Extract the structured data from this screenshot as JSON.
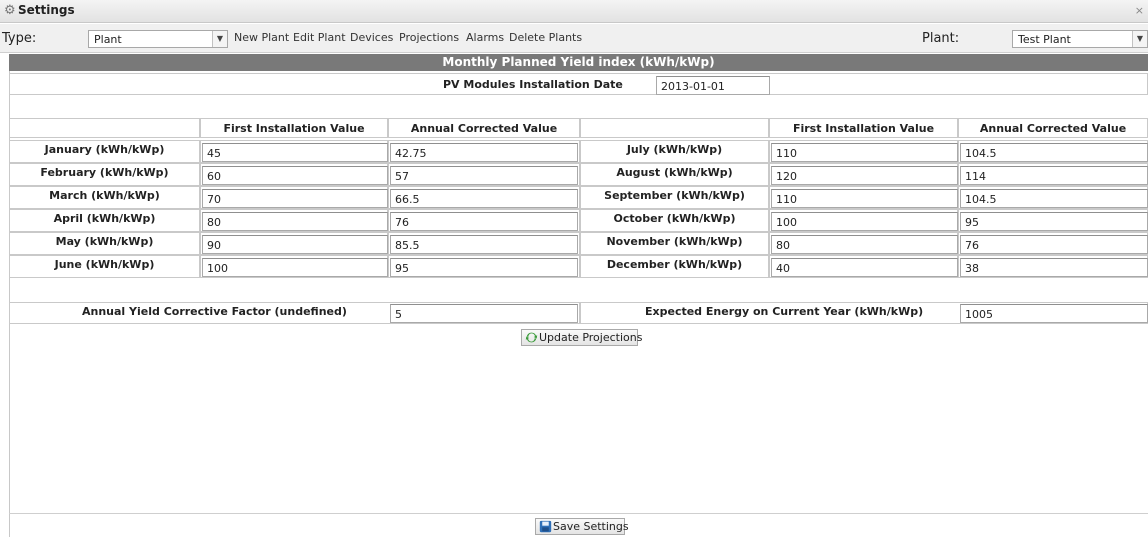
{
  "window": {
    "title": "Settings",
    "close": "×"
  },
  "toolbar": {
    "type_label": "Type:",
    "type_value": "Plant",
    "links": [
      "New Plant",
      "Edit Plant",
      "Devices",
      "Projections",
      "Alarms",
      "Delete Plants"
    ],
    "plant_label": "Plant:",
    "plant_value": "Test Plant"
  },
  "section_title": "Monthly Planned Yield index (kWh/kWp)",
  "install_date": {
    "label": "PV Modules Installation Date",
    "value": "2013-01-01"
  },
  "columns": {
    "first": "First Installation Value",
    "corrected": "Annual Corrected Value"
  },
  "months_left": [
    {
      "label": "January (kWh/kWp)",
      "first": "45",
      "corrected": "42.75"
    },
    {
      "label": "February (kWh/kWp)",
      "first": "60",
      "corrected": "57"
    },
    {
      "label": "March (kWh/kWp)",
      "first": "70",
      "corrected": "66.5"
    },
    {
      "label": "April (kWh/kWp)",
      "first": "80",
      "corrected": "76"
    },
    {
      "label": "May (kWh/kWp)",
      "first": "90",
      "corrected": "85.5"
    },
    {
      "label": "June (kWh/kWp)",
      "first": "100",
      "corrected": "95"
    }
  ],
  "months_right": [
    {
      "label": "July (kWh/kWp)",
      "first": "110",
      "corrected": "104.5"
    },
    {
      "label": "August (kWh/kWp)",
      "first": "120",
      "corrected": "114"
    },
    {
      "label": "September (kWh/kWp)",
      "first": "110",
      "corrected": "104.5"
    },
    {
      "label": "October (kWh/kWp)",
      "first": "100",
      "corrected": "95"
    },
    {
      "label": "November (kWh/kWp)",
      "first": "80",
      "corrected": "76"
    },
    {
      "label": "December (kWh/kWp)",
      "first": "40",
      "corrected": "38"
    }
  ],
  "corrective_factor": {
    "label": "Annual Yield Corrective Factor (undefined)",
    "value": "5"
  },
  "expected_energy": {
    "label": "Expected Energy on Current Year (kWh/kWp)",
    "value": "1005"
  },
  "buttons": {
    "update": "Update Projections",
    "save": "Save Settings"
  },
  "icons": {
    "settings": "gear-icon",
    "update": "refresh-icon",
    "save": "floppy-disk-icon"
  },
  "colors": {
    "section_bar": "#797979",
    "update_icon": "#3a9b3a",
    "save_icon": "#2f6fb7"
  }
}
